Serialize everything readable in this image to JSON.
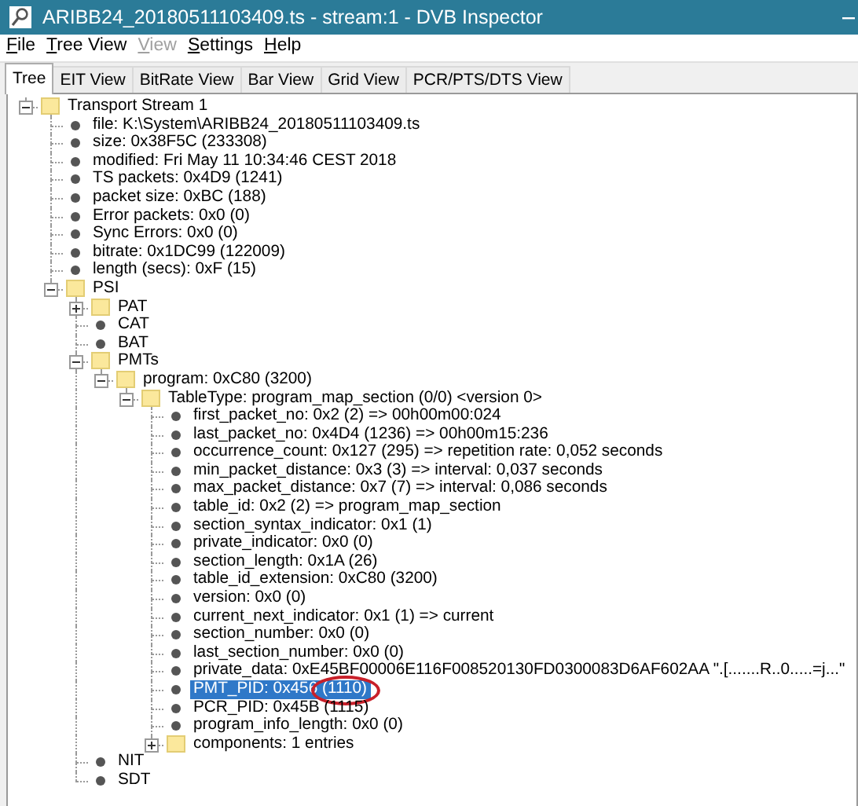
{
  "window": {
    "title": "ARIBB24_20180511103409.ts - stream:1 - DVB Inspector"
  },
  "menu": [
    {
      "label": "File",
      "disabled": false
    },
    {
      "label": "Tree View",
      "disabled": false
    },
    {
      "label": "View",
      "disabled": true
    },
    {
      "label": "Settings",
      "disabled": false
    },
    {
      "label": "Help",
      "disabled": false
    }
  ],
  "tabs": [
    {
      "label": "Tree",
      "selected": true
    },
    {
      "label": "EIT View",
      "selected": false
    },
    {
      "label": "BitRate View",
      "selected": false
    },
    {
      "label": "Bar View",
      "selected": false
    },
    {
      "label": "Grid View",
      "selected": false
    },
    {
      "label": "PCR/PTS/DTS View",
      "selected": false
    }
  ],
  "tree": [
    {
      "kind": "folder",
      "label": "Transport Stream 1",
      "expanded": true,
      "selected": false,
      "children": [
        {
          "kind": "leaf",
          "label": "file: K:\\System\\ARIBB24_20180511103409.ts",
          "selected": false
        },
        {
          "kind": "leaf",
          "label": "size: 0x38F5C (233308)",
          "selected": false
        },
        {
          "kind": "leaf",
          "label": "modified: Fri May 11 10:34:46 CEST 2018",
          "selected": false
        },
        {
          "kind": "leaf",
          "label": "TS packets: 0x4D9 (1241)",
          "selected": false
        },
        {
          "kind": "leaf",
          "label": "packet size: 0xBC (188)",
          "selected": false
        },
        {
          "kind": "leaf",
          "label": "Error packets: 0x0 (0)",
          "selected": false
        },
        {
          "kind": "leaf",
          "label": "Sync Errors: 0x0 (0)",
          "selected": false
        },
        {
          "kind": "leaf",
          "label": "bitrate: 0x1DC99 (122009)",
          "selected": false
        },
        {
          "kind": "leaf",
          "label": "length (secs): 0xF (15)",
          "selected": false
        },
        {
          "kind": "folder",
          "label": "PSI",
          "expanded": true,
          "selected": false,
          "children": [
            {
              "kind": "folder",
              "label": "PAT",
              "expanded": false,
              "selected": false
            },
            {
              "kind": "leaf",
              "label": "CAT",
              "selected": false
            },
            {
              "kind": "leaf",
              "label": "BAT",
              "selected": false
            },
            {
              "kind": "folder",
              "label": "PMTs",
              "expanded": true,
              "selected": false,
              "children": [
                {
                  "kind": "folder",
                  "label": "program: 0xC80 (3200)",
                  "expanded": true,
                  "selected": false,
                  "children": [
                    {
                      "kind": "folder",
                      "label": "TableType: program_map_section (0/0) <version 0>",
                      "expanded": true,
                      "selected": false,
                      "children": [
                        {
                          "kind": "leaf",
                          "label": "first_packet_no: 0x2 (2) => 00h00m00:024",
                          "selected": false
                        },
                        {
                          "kind": "leaf",
                          "label": "last_packet_no: 0x4D4 (1236) => 00h00m15:236",
                          "selected": false
                        },
                        {
                          "kind": "leaf",
                          "label": "occurrence_count: 0x127 (295) => repetition rate: 0,052 seconds",
                          "selected": false
                        },
                        {
                          "kind": "leaf",
                          "label": "min_packet_distance: 0x3 (3) => interval: 0,037 seconds",
                          "selected": false
                        },
                        {
                          "kind": "leaf",
                          "label": "max_packet_distance: 0x7 (7) => interval: 0,086 seconds",
                          "selected": false
                        },
                        {
                          "kind": "leaf",
                          "label": "table_id: 0x2 (2) => program_map_section",
                          "selected": false
                        },
                        {
                          "kind": "leaf",
                          "label": "section_syntax_indicator: 0x1 (1)",
                          "selected": false
                        },
                        {
                          "kind": "leaf",
                          "label": "private_indicator: 0x0 (0)",
                          "selected": false
                        },
                        {
                          "kind": "leaf",
                          "label": "section_length: 0x1A (26)",
                          "selected": false
                        },
                        {
                          "kind": "leaf",
                          "label": "table_id_extension: 0xC80 (3200)",
                          "selected": false
                        },
                        {
                          "kind": "leaf",
                          "label": "version: 0x0 (0)",
                          "selected": false
                        },
                        {
                          "kind": "leaf",
                          "label": "current_next_indicator: 0x1 (1) => current",
                          "selected": false
                        },
                        {
                          "kind": "leaf",
                          "label": "section_number: 0x0 (0)",
                          "selected": false
                        },
                        {
                          "kind": "leaf",
                          "label": "last_section_number: 0x0 (0)",
                          "selected": false
                        },
                        {
                          "kind": "leaf",
                          "label": "private_data: 0xE45BF00006E116F008520130FD0300083D6AF602AA \".[.......R..0.....=j...\"",
                          "selected": false
                        },
                        {
                          "kind": "leaf",
                          "label": "PMT_PID: 0x456 (1110)",
                          "selected": true,
                          "circled": true
                        },
                        {
                          "kind": "leaf",
                          "label": "PCR_PID: 0x45B (1115)",
                          "selected": false
                        },
                        {
                          "kind": "leaf",
                          "label": "program_info_length: 0x0 (0)",
                          "selected": false
                        },
                        {
                          "kind": "folder",
                          "label": "components: 1 entries",
                          "expanded": false,
                          "selected": false
                        }
                      ]
                    }
                  ]
                }
              ]
            },
            {
              "kind": "leaf",
              "label": "NIT",
              "selected": false
            },
            {
              "kind": "leaf",
              "label": "SDT",
              "selected": false
            }
          ]
        }
      ]
    }
  ]
}
